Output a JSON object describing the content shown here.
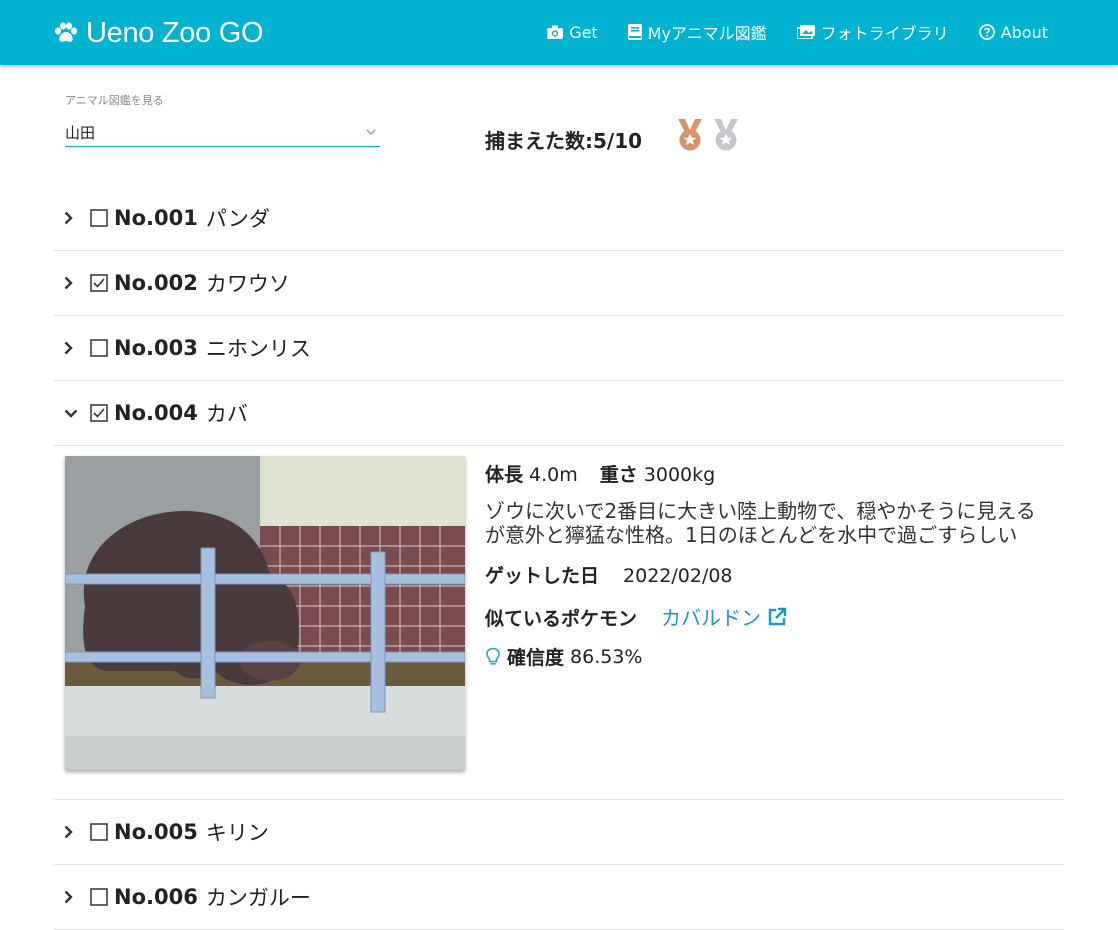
{
  "header": {
    "title": "Ueno Zoo GO",
    "nav": [
      "Get",
      "Myアニマル図鑑",
      "フォトライブラリ",
      "About"
    ]
  },
  "selector": {
    "label": "アニマル図鑑を見る",
    "value": "山田"
  },
  "count_text": "捕まえた数:5/10",
  "animals": [
    {
      "no": "No.001",
      "name": "パンダ",
      "checked": false,
      "expanded": false
    },
    {
      "no": "No.002",
      "name": "カワウソ",
      "checked": true,
      "expanded": false
    },
    {
      "no": "No.003",
      "name": "ニホンリス",
      "checked": false,
      "expanded": false
    },
    {
      "no": "No.004",
      "name": "カバ",
      "checked": true,
      "expanded": true
    },
    {
      "no": "No.005",
      "name": "キリン",
      "checked": false,
      "expanded": false
    },
    {
      "no": "No.006",
      "name": "カンガルー",
      "checked": false,
      "expanded": false
    }
  ],
  "detail": {
    "length_label": "体長",
    "length_value": "4.0m",
    "weight_label": "重さ",
    "weight_value": "3000kg",
    "description": "ゾウに次いで2番目に大きい陸上動物で、穏やかそうに見えるが意外と獰猛な性格。1日のほとんどを水中で過ごすらしい",
    "got_label": "ゲットした日",
    "got_date": "2022/02/08",
    "pokemon_label": "似ているポケモン",
    "pokemon_name": "カバルドン",
    "confidence_label": "確信度",
    "confidence_value": "86.53%"
  },
  "colors": {
    "header": "#00b3d1",
    "link": "#1a96d2",
    "bronze": "#d9926a",
    "silver": "#c4c8cc"
  }
}
